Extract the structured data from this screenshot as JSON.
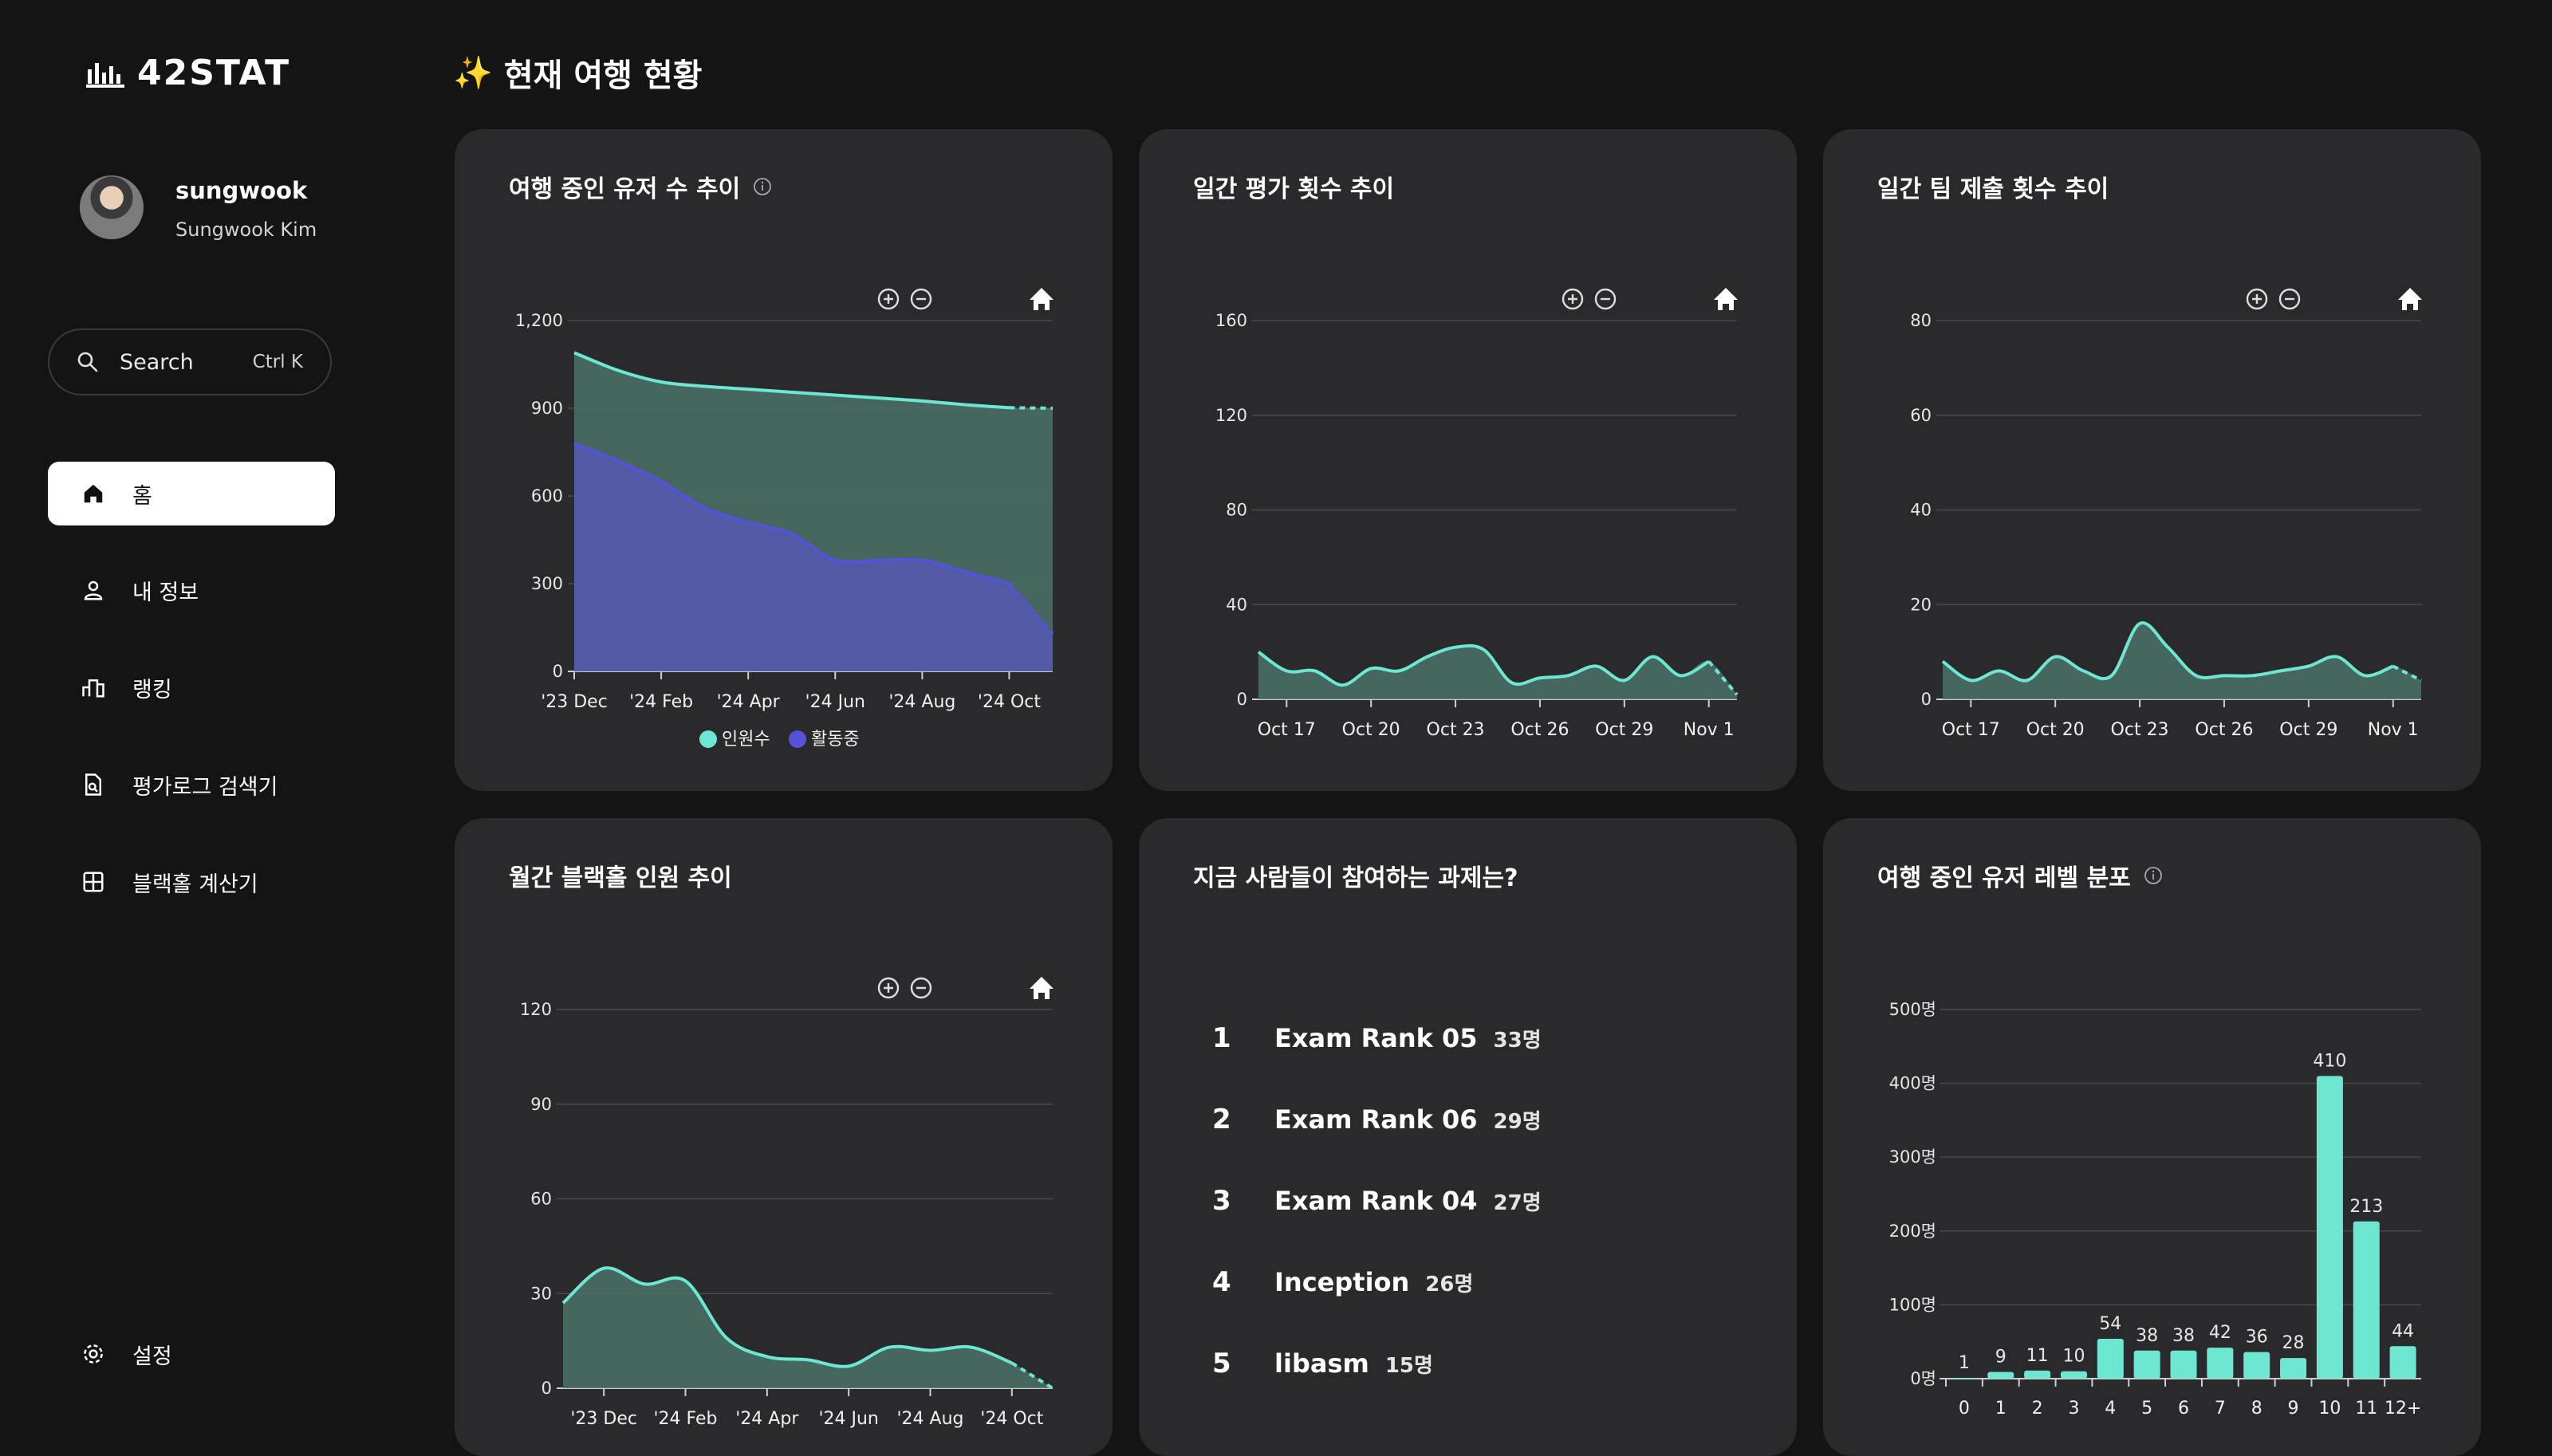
{
  "brand": {
    "name": "42STAT"
  },
  "user": {
    "login": "sungwook",
    "full_name": "Sungwook Kim"
  },
  "search": {
    "label": "Search",
    "shortcut": "Ctrl K"
  },
  "nav": [
    {
      "label": "홈",
      "icon": "home-icon",
      "active": true
    },
    {
      "label": "내 정보",
      "icon": "user-icon",
      "active": false
    },
    {
      "label": "랭킹",
      "icon": "ranking-icon",
      "active": false
    },
    {
      "label": "평가로그 검색기",
      "icon": "log-search-icon",
      "active": false
    },
    {
      "label": "블랙홀 계산기",
      "icon": "calculator-icon",
      "active": false
    }
  ],
  "settings": {
    "label": "설정"
  },
  "page": {
    "title": "현재 여행 현황",
    "emoji": "✨"
  },
  "cards": {
    "users": {
      "title": "여행 중인 유저 수 추이"
    },
    "evals": {
      "title": "일간 평가 횟수 추이"
    },
    "teams": {
      "title": "일간 팀 제출 횟수 추이"
    },
    "blackhole": {
      "title": "월간 블랙홀 인원 추이"
    },
    "projects": {
      "title": "지금 사람들이 참여하는 과제는?"
    },
    "levels": {
      "title": "여행 중인 유저 레벨 분포"
    }
  },
  "colors": {
    "accent": "#6ee7d2",
    "active": "#5553d8",
    "card": "#2a2a2d",
    "bg": "#141414"
  },
  "projects": [
    {
      "rank": "1",
      "name": "Exam Rank 05",
      "count": "33명"
    },
    {
      "rank": "2",
      "name": "Exam Rank 06",
      "count": "29명"
    },
    {
      "rank": "3",
      "name": "Exam Rank 04",
      "count": "27명"
    },
    {
      "rank": "4",
      "name": "Inception",
      "count": "26명"
    },
    {
      "rank": "5",
      "name": "libasm",
      "count": "15명"
    }
  ],
  "chart_data": [
    {
      "id": "users",
      "type": "area",
      "title": "여행 중인 유저 수 추이",
      "ylim": [
        0,
        1200
      ],
      "yticks": [
        "0",
        "300",
        "600",
        "900",
        "1,200"
      ],
      "xticks": [
        "'23 Dec",
        "'24 Feb",
        "'24 Apr",
        "'24 Jun",
        "'24 Aug",
        "'24 Oct"
      ],
      "x": [
        "'23 Dec",
        "'24 Jan",
        "'24 Feb",
        "'24 Mar",
        "'24 Apr",
        "'24 May",
        "'24 Jun",
        "'24 Jul",
        "'24 Aug",
        "'24 Sep",
        "'24 Oct",
        "'24 Nov"
      ],
      "series": [
        {
          "name": "인원수",
          "color": "#6ee7d2",
          "values": [
            1090,
            1030,
            990,
            975,
            965,
            955,
            945,
            935,
            925,
            912,
            902,
            900
          ]
        },
        {
          "name": "활동중",
          "color": "#5553d8",
          "values": [
            780,
            720,
            650,
            560,
            510,
            470,
            380,
            380,
            380,
            340,
            300,
            130
          ]
        }
      ],
      "legend": "bottom",
      "grid": true
    },
    {
      "id": "evals",
      "type": "area",
      "title": "일간 평가 횟수 추이",
      "ylim": [
        0,
        160
      ],
      "yticks": [
        "0",
        "40",
        "80",
        "120",
        "160"
      ],
      "xticks": [
        "Oct 17",
        "Oct 20",
        "Oct 23",
        "Oct 26",
        "Oct 29",
        "Nov 1"
      ],
      "x": [
        "Oct 16",
        "Oct 17",
        "Oct 18",
        "Oct 19",
        "Oct 20",
        "Oct 21",
        "Oct 22",
        "Oct 23",
        "Oct 24",
        "Oct 25",
        "Oct 26",
        "Oct 27",
        "Oct 28",
        "Oct 29",
        "Oct 30",
        "Oct 31",
        "Nov 1",
        "Nov 2"
      ],
      "series": [
        {
          "name": "평가",
          "color": "#6ee7d2",
          "values": [
            20,
            12,
            12,
            6,
            13,
            12,
            18,
            22,
            21,
            7,
            9,
            10,
            14,
            8,
            18,
            10,
            16,
            2
          ]
        }
      ],
      "grid": true
    },
    {
      "id": "teams",
      "type": "area",
      "title": "일간 팀 제출 횟수 추이",
      "ylim": [
        0,
        80
      ],
      "yticks": [
        "0",
        "20",
        "40",
        "60",
        "80"
      ],
      "xticks": [
        "Oct 17",
        "Oct 20",
        "Oct 23",
        "Oct 26",
        "Oct 29",
        "Nov 1"
      ],
      "x": [
        "Oct 16",
        "Oct 17",
        "Oct 18",
        "Oct 19",
        "Oct 20",
        "Oct 21",
        "Oct 22",
        "Oct 23",
        "Oct 24",
        "Oct 25",
        "Oct 26",
        "Oct 27",
        "Oct 28",
        "Oct 29",
        "Oct 30",
        "Oct 31",
        "Nov 1",
        "Nov 2"
      ],
      "series": [
        {
          "name": "팀 제출",
          "color": "#6ee7d2",
          "values": [
            8,
            4,
            6,
            4,
            9,
            6,
            5,
            16,
            11,
            5,
            5,
            5,
            6,
            7,
            9,
            5,
            7,
            4
          ]
        }
      ],
      "grid": true
    },
    {
      "id": "blackhole",
      "type": "area",
      "title": "월간 블랙홀 인원 추이",
      "ylim": [
        0,
        120
      ],
      "yticks": [
        "0",
        "30",
        "60",
        "90",
        "120"
      ],
      "xticks": [
        "'23 Dec",
        "'24 Feb",
        "'24 Apr",
        "'24 Jun",
        "'24 Aug",
        "'24 Oct"
      ],
      "x": [
        "'23 Nov",
        "'23 Dec",
        "'24 Jan",
        "'24 Feb",
        "'24 Mar",
        "'24 Apr",
        "'24 May",
        "'24 Jun",
        "'24 Jul",
        "'24 Aug",
        "'24 Sep",
        "'24 Oct",
        "'24 Nov"
      ],
      "series": [
        {
          "name": "블랙홀",
          "color": "#6ee7d2",
          "values": [
            27,
            38,
            33,
            34,
            16,
            10,
            9,
            7,
            13,
            12,
            13,
            8,
            0
          ]
        }
      ],
      "grid": true
    },
    {
      "id": "levels",
      "type": "bar",
      "title": "여행 중인 유저 레벨 분포",
      "ylim": [
        0,
        500
      ],
      "yticks": [
        "0명",
        "100명",
        "200명",
        "300명",
        "400명",
        "500명"
      ],
      "categories": [
        "0",
        "1",
        "2",
        "3",
        "4",
        "5",
        "6",
        "7",
        "8",
        "9",
        "10",
        "11",
        "12+"
      ],
      "values": [
        1,
        9,
        11,
        10,
        54,
        38,
        38,
        42,
        36,
        28,
        410,
        213,
        44
      ],
      "grid": true
    }
  ]
}
